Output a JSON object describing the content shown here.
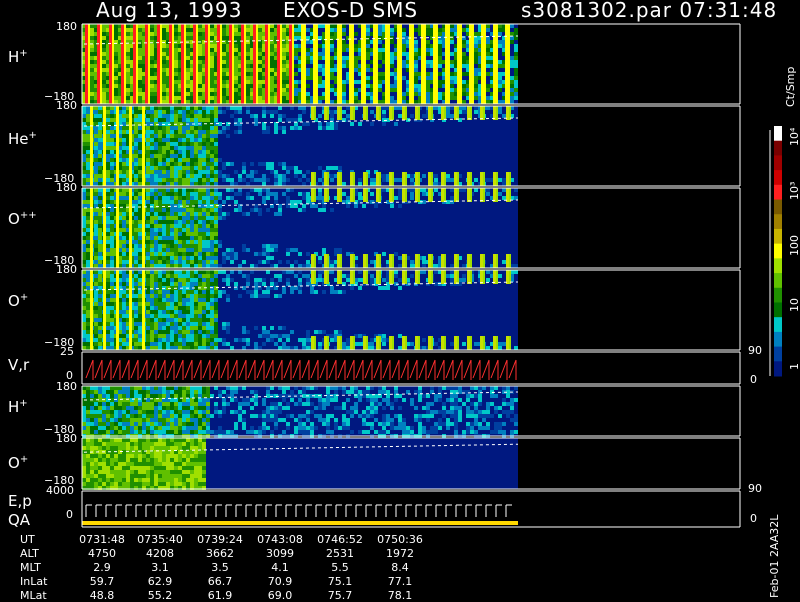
{
  "header": {
    "date": "Aug 13, 1993",
    "instrument": "EXOS-D SMS",
    "file_time": "s3081302.par  07:31:48"
  },
  "panels": [
    {
      "id": "h-plus",
      "label": "H",
      "sup": "+",
      "ytop": "180",
      "ybot": "−180"
    },
    {
      "id": "he-plus",
      "label": "He",
      "sup": "+",
      "ytop": "180",
      "ybot": "−180"
    },
    {
      "id": "o-plusplus",
      "label": "O",
      "sup": "++",
      "ytop": "180",
      "ybot": "−180"
    },
    {
      "id": "o-plus",
      "label": "O",
      "sup": "+",
      "ytop": "180",
      "ybot": "−180"
    },
    {
      "id": "vr",
      "label": "V,r",
      "sup": "",
      "ytop": "25",
      "ybot": "0",
      "rtop": "90",
      "rbot": "0"
    },
    {
      "id": "h-plus-2",
      "label": "H",
      "sup": "+",
      "ytop": "180",
      "ybot": "−180"
    },
    {
      "id": "o-plus-2",
      "label": "O",
      "sup": "+",
      "ytop": "180",
      "ybot": "−180"
    },
    {
      "id": "ep-qa",
      "label": "E,p",
      "label2": "QA",
      "ytop": "4000",
      "ybot": "0",
      "rtop": "90",
      "rbot": "0"
    }
  ],
  "colorbar": {
    "units": "Ct/Smp",
    "ticks": [
      "10⁴",
      "10³",
      "100",
      "10",
      "1"
    ],
    "colors": [
      "#ffffff",
      "#7a0000",
      "#a00000",
      "#d00000",
      "#ff2020",
      "#7a5a00",
      "#a08000",
      "#c8b400",
      "#ffff00",
      "#a0e000",
      "#60c000",
      "#209000",
      "#007000",
      "#00c8c8",
      "#0080c0",
      "#0040a0",
      "#001880"
    ]
  },
  "ephemeris": {
    "rows": [
      {
        "label": "UT",
        "values": [
          "0731:48",
          "0735:40",
          "0739:24",
          "0743:08",
          "0746:52",
          "0750:36"
        ]
      },
      {
        "label": "ALT",
        "values": [
          "4750",
          "4208",
          "3662",
          "3099",
          "2531",
          "1972"
        ]
      },
      {
        "label": "MLT",
        "values": [
          "2.9",
          "3.1",
          "3.5",
          "4.1",
          "5.5",
          "8.4"
        ]
      },
      {
        "label": "InLat",
        "values": [
          "59.7",
          "62.9",
          "66.7",
          "70.9",
          "75.1",
          "77.1"
        ]
      },
      {
        "label": "MLat",
        "values": [
          "48.8",
          "55.2",
          "61.9",
          "69.0",
          "75.7",
          "78.1"
        ]
      }
    ]
  },
  "footer": {
    "stamp": "Feb-01 2AA32L"
  },
  "chart_data": {
    "type": "heatmap",
    "title": "Aug 13, 1993   EXOS-D SMS",
    "x_ticks": [
      "0731:48",
      "0735:40",
      "0739:24",
      "0743:08",
      "0746:52",
      "0750:36"
    ],
    "colorbar_units": "Ct/Smp",
    "colorbar_range": [
      1,
      10000
    ],
    "colorbar_scale": "log",
    "panels": [
      "H+",
      "He+",
      "O++",
      "O+",
      "V,r",
      "H+",
      "O+",
      "E,p QA"
    ],
    "pitch_angle_range": [
      -180,
      180
    ]
  }
}
